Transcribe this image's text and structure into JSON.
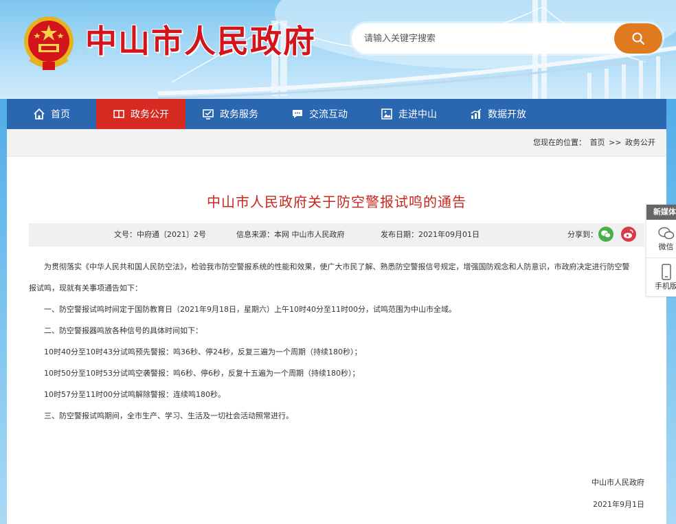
{
  "header": {
    "site_title": "中山市人民政府",
    "search_placeholder": "请输入关键字搜索"
  },
  "nav": {
    "items": [
      {
        "label": "首页",
        "icon": "home-icon"
      },
      {
        "label": "政务公开",
        "icon": "book-icon",
        "active": true
      },
      {
        "label": "政务服务",
        "icon": "monitor-icon"
      },
      {
        "label": "交流互动",
        "icon": "chat-icon"
      },
      {
        "label": "走进中山",
        "icon": "picture-icon"
      },
      {
        "label": "数据开放",
        "icon": "bar-chart-icon"
      }
    ]
  },
  "breadcrumb": {
    "prefix": "您现在的位置：",
    "home": "首页",
    "sep": ">>",
    "current": "政务公开"
  },
  "article": {
    "title": "中山市人民政府关于防空警报试鸣的通告",
    "meta": {
      "doc_no": "文号：中府通〔2021〕2号",
      "source": "信息来源：本网 中山市人民政府",
      "date": "发布日期：2021年09月01日",
      "share": "分享到："
    },
    "intro_line1": "为贯彻落实《中华人民共和国人民防空法》，检验我市防空警报系统的性能和效果，使广大市民了解、熟悉防空警报信号规定，增强国防观念和人防意识，市政府决定进行防空警",
    "intro_line2": "报试鸣，现就有关事项通告如下：",
    "para1": "一、防空警报试鸣时间定于国防教育日（2021年9月18日，星期六）上午10时40分至11时00分，试鸣范围为中山市全域。",
    "para2": "二、防空警报器鸣放各种信号的具体时间如下：",
    "para3": "10时40分至10时43分试鸣预先警报：鸣36秒、停24秒，反复三遍为一个周期（持续180秒）；",
    "para4": "10时50分至10时53分试鸣空袭警报：鸣6秒、停6秒，反复十五遍为一个周期（持续180秒）；",
    "para5": "10时57分至11时00分试鸣解除警报：连续鸣180秒。",
    "para6": "三、防空警报试鸣期间，全市生产、学习、生活及一切社会活动照常进行。",
    "signature_org": "中山市人民政府",
    "signature_date": "2021年9月1日"
  },
  "side_widget": {
    "heading": "新媒体",
    "wechat": "微信",
    "mobile": "手机版"
  },
  "colors": {
    "nav_bg": "#2a67b0",
    "nav_active": "#d72a23",
    "title_red": "#c9261c",
    "search_btn": "#e07a1f"
  }
}
